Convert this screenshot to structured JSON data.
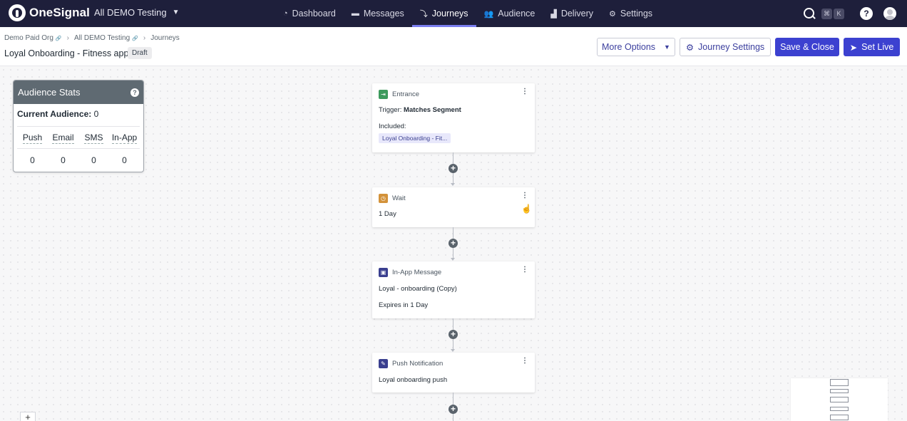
{
  "nav": {
    "brand": "OneSignal",
    "app_name": "All DEMO Testing",
    "items": [
      {
        "label": "Dashboard",
        "icon": "dashboard-icon"
      },
      {
        "label": "Messages",
        "icon": "messages-icon"
      },
      {
        "label": "Journeys",
        "icon": "journeys-icon"
      },
      {
        "label": "Audience",
        "icon": "audience-icon"
      },
      {
        "label": "Delivery",
        "icon": "delivery-icon"
      },
      {
        "label": "Settings",
        "icon": "gear-icon"
      }
    ],
    "active": "Journeys",
    "shortcut_keys": [
      "⌘",
      "K"
    ],
    "help": "?"
  },
  "breadcrumb": [
    "Demo Paid Org",
    "All DEMO Testing",
    "Journeys"
  ],
  "page": {
    "title": "Loyal Onboarding - Fitness app",
    "status": "Draft"
  },
  "actions": {
    "more_options": "More Options",
    "journey_settings": "Journey Settings",
    "save_close": "Save & Close",
    "set_live": "Set Live"
  },
  "audience_stats": {
    "title": "Audience Stats",
    "current_label": "Current Audience:",
    "current_value": "0",
    "columns": [
      "Push",
      "Email",
      "SMS",
      "In-App"
    ],
    "values": [
      "0",
      "0",
      "0",
      "0"
    ]
  },
  "nodes": [
    {
      "type": "Entrance",
      "color": "#3c9a5c",
      "trigger_label": "Trigger:",
      "trigger_value": "Matches Segment",
      "included_label": "Included:",
      "segment": "Loyal Onboarding - Fit..."
    },
    {
      "type": "Wait",
      "color": "#d3923a",
      "detail": "1 Day"
    },
    {
      "type": "In-App Message",
      "color": "#3a3f8f",
      "detail": "Loyal - onboarding (Copy)",
      "extra": "Expires in 1 Day"
    },
    {
      "type": "Push Notification",
      "color": "#3a3f8f",
      "detail": "Loyal onboarding push"
    }
  ]
}
